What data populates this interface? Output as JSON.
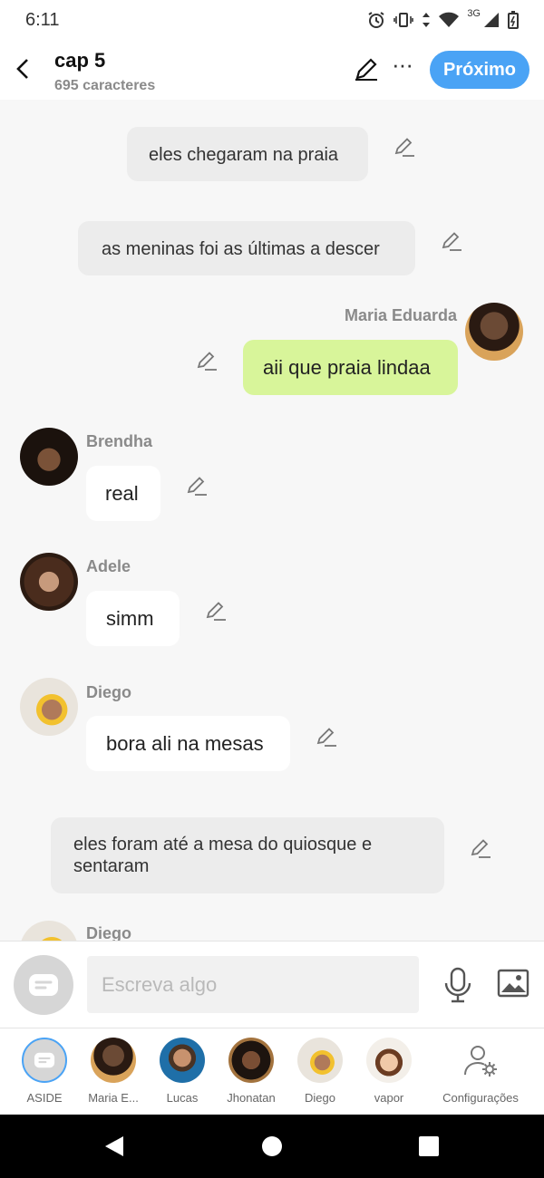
{
  "status": {
    "time": "6:11",
    "network": "3G"
  },
  "header": {
    "title": "cap 5",
    "subtitle": "695 caracteres",
    "next_label": "Próximo"
  },
  "messages": [
    {
      "kind": "narration",
      "text": "eles chegaram na praia"
    },
    {
      "kind": "narration",
      "text": "as meninas foi as últimas a descer"
    },
    {
      "kind": "right",
      "name": "Maria Eduarda",
      "text": "aii que praia lindaa"
    },
    {
      "kind": "left",
      "name": "Brendha",
      "text": "real"
    },
    {
      "kind": "left",
      "name": "Adele",
      "text": "simm"
    },
    {
      "kind": "left",
      "name": "Diego",
      "text": "bora ali na mesas"
    },
    {
      "kind": "narration",
      "text": "eles foram até a mesa do quiosque e sentaram"
    },
    {
      "kind": "left",
      "name": "Diego",
      "text": ""
    }
  ],
  "composer": {
    "placeholder": "Escreva algo"
  },
  "characters": [
    {
      "label": "ASIDE"
    },
    {
      "label": "Maria E..."
    },
    {
      "label": "Lucas"
    },
    {
      "label": "Jhonatan"
    },
    {
      "label": "Diego"
    },
    {
      "label": "vapor"
    },
    {
      "label": "Configurações"
    }
  ],
  "colors": {
    "accent": "#4aa3f5",
    "user_bubble": "#d8f59a",
    "narration_bubble": "#ececec",
    "chat_bg": "#f7f7f7"
  }
}
